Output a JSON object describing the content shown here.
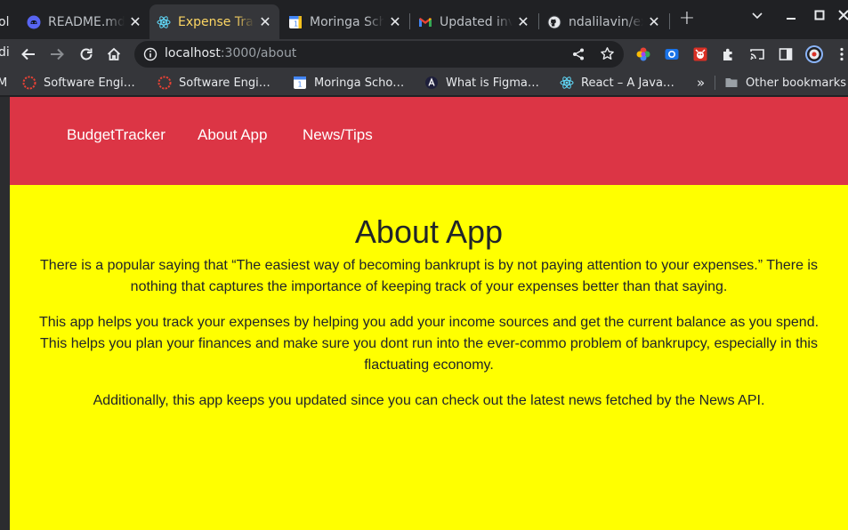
{
  "browser": {
    "tabs": [
      {
        "title": "README.md",
        "icon": "github-icon",
        "active": false
      },
      {
        "title": "Expense Tracker",
        "icon": "react-icon",
        "active": true
      },
      {
        "title": "Moringa School",
        "icon": "calendar-icon",
        "active": false
      },
      {
        "title": "Updated invite",
        "icon": "gmail-icon",
        "active": false
      },
      {
        "title": "ndalilavin/expense",
        "icon": "github-icon",
        "active": false
      }
    ],
    "partial_left_tab_text": "ol",
    "new_tab_symbol": "+",
    "tab_close_symbol": "✕",
    "url_host": "localhost",
    "url_path": ":3000/about",
    "bookmarks": [
      {
        "label": "Software Engi…",
        "icon": "moringa-icon"
      },
      {
        "label": "Software Engi…",
        "icon": "moringa-icon"
      },
      {
        "label": "Moringa Scho…",
        "icon": "calendar-icon"
      },
      {
        "label": "What is Figma…",
        "icon": "figma-academy-icon"
      },
      {
        "label": "React – A Java…",
        "icon": "react-icon"
      }
    ],
    "bookmarks_overflow": "»",
    "other_bookmarks": "Other bookmarks",
    "partial_left_bookmark": "M",
    "partial_left_toolbar": "di"
  },
  "navbar": {
    "brand": "BudgetTracker",
    "links": [
      "About App",
      "News/Tips"
    ]
  },
  "about": {
    "heading": "About App",
    "paragraphs": [
      "There is a popular saying that “The easiest way of becoming bankrupt is by not paying attention to your expenses.” There is nothing that captures the importance of keeping track of your expenses better than that saying.",
      "This app helps you track your expenses by helping you add your income sources and get the current balance as you spend. This helps you plan your finances and make sure you dont run into the ever-commo problem of bankrupcy, especially in this flactuating economy.",
      "Additionally, this app keeps you updated since you can check out the latest news fetched by the News API."
    ]
  },
  "colors": {
    "navbar_bg": "#dc3545",
    "page_bg": "#ffff00",
    "text": "#212529",
    "active_tab_title": "#fdd663"
  }
}
